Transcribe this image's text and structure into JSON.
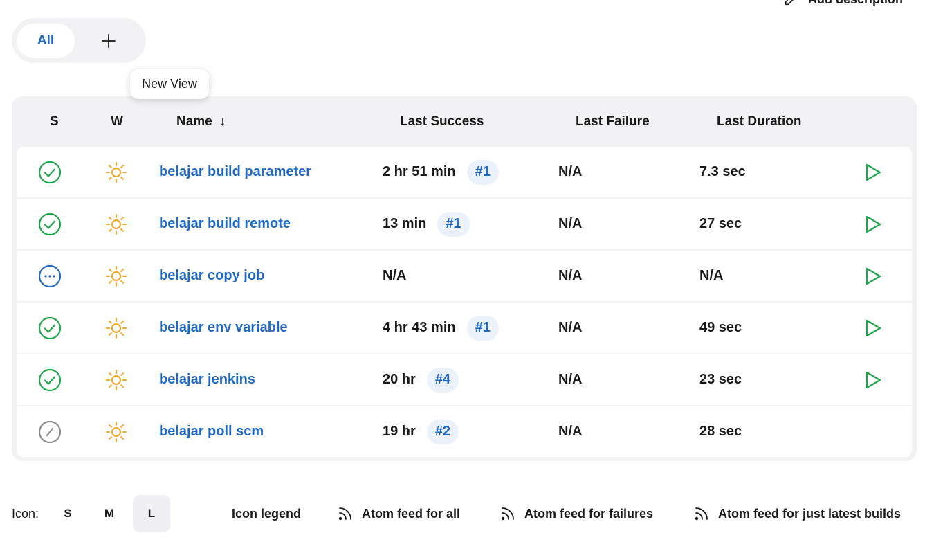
{
  "top_actions": {
    "add_description": "Add description"
  },
  "views": {
    "tabs": [
      {
        "label": "All"
      }
    ],
    "new_view_tooltip": "New View"
  },
  "table": {
    "headers": {
      "status": "S",
      "weather": "W",
      "name": "Name",
      "name_sort": "↓",
      "last_success": "Last Success",
      "last_failure": "Last Failure",
      "last_duration": "Last Duration"
    },
    "rows": [
      {
        "status": "success",
        "weather": "sunny",
        "name": "belajar build parameter",
        "last_success": "2 hr 51 min",
        "last_success_build": "#1",
        "last_failure": "N/A",
        "last_duration": "7.3 sec",
        "run": true
      },
      {
        "status": "success",
        "weather": "sunny",
        "name": "belajar build remote",
        "last_success": "13 min",
        "last_success_build": "#1",
        "last_failure": "N/A",
        "last_duration": "27 sec",
        "run": true
      },
      {
        "status": "not-built",
        "weather": "sunny",
        "name": "belajar copy job",
        "last_success": "N/A",
        "last_success_build": "",
        "last_failure": "N/A",
        "last_duration": "N/A",
        "run": true
      },
      {
        "status": "success",
        "weather": "sunny",
        "name": "belajar env variable",
        "last_success": "4 hr 43 min",
        "last_success_build": "#1",
        "last_failure": "N/A",
        "last_duration": "49 sec",
        "run": true
      },
      {
        "status": "success",
        "weather": "sunny",
        "name": "belajar jenkins",
        "last_success": "20 hr",
        "last_success_build": "#4",
        "last_failure": "N/A",
        "last_duration": "23 sec",
        "run": true
      },
      {
        "status": "disabled",
        "weather": "sunny",
        "name": "belajar poll scm",
        "last_success": "19 hr",
        "last_success_build": "#2",
        "last_failure": "N/A",
        "last_duration": "28 sec",
        "run": false
      }
    ]
  },
  "footer": {
    "icon_label": "Icon:",
    "sizes": [
      "S",
      "M",
      "L"
    ],
    "active_size": "L",
    "legend": "Icon legend",
    "feeds": [
      "Atom feed for all",
      "Atom feed for failures",
      "Atom feed for just latest builds"
    ]
  },
  "colors": {
    "accent": "#1f69c9",
    "success": "#1ea64b",
    "weather_sunny": "#f5a623",
    "disabled": "#8a8a8a",
    "table_bg": "#f2f2f5",
    "badge_bg": "#ecf2fb"
  }
}
